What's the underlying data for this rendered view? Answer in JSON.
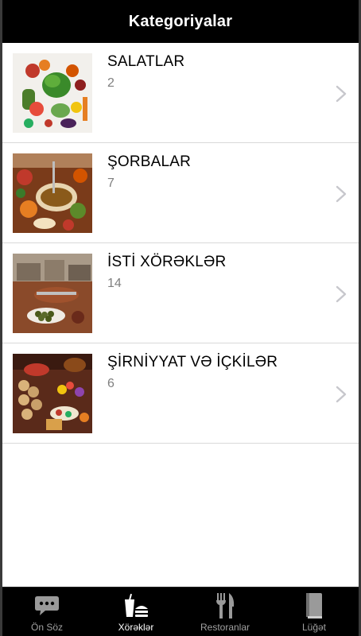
{
  "header": {
    "title": "Kategoriyalar"
  },
  "categories": [
    {
      "title": "SALATLAR",
      "count": "2",
      "image": "vegetables-photo"
    },
    {
      "title": "ŞORBALAR",
      "count": "7",
      "image": "soup-table-photo"
    },
    {
      "title": "İSTİ XÖRƏKLƏR",
      "count": "14",
      "image": "hot-dishes-photo"
    },
    {
      "title": "ŞİRNİYYAT VƏ İÇKİLƏR",
      "count": "6",
      "image": "sweets-drinks-photo"
    }
  ],
  "tabbar": {
    "active_index": 1,
    "items": [
      {
        "label": "Ön Söz",
        "icon": "speech-bubble-icon"
      },
      {
        "label": "Xörəklər",
        "icon": "food-drink-icon"
      },
      {
        "label": "Restoranlar",
        "icon": "fork-knife-icon"
      },
      {
        "label": "Lüğət",
        "icon": "book-icon"
      }
    ]
  },
  "colors": {
    "bar": "#000000",
    "separator": "#d9d9d9",
    "count_text": "#7f7f7f",
    "chevron": "#c7c7cc"
  }
}
